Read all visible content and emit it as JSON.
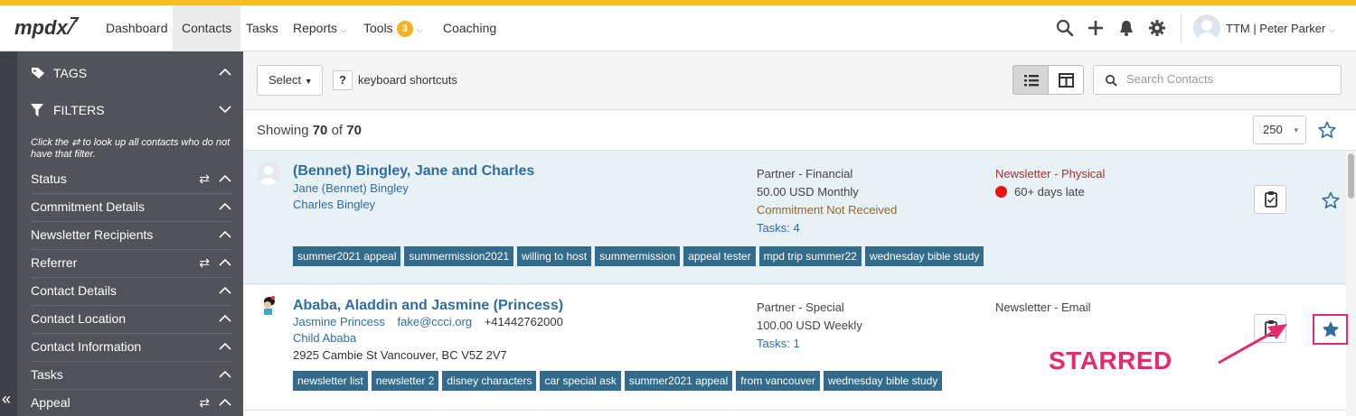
{
  "app": {
    "logo_text": "mpdx"
  },
  "nav": {
    "items": [
      {
        "label": "Dashboard"
      },
      {
        "label": "Contacts"
      },
      {
        "label": "Tasks"
      },
      {
        "label": "Reports"
      },
      {
        "label": "Tools"
      },
      {
        "label": "Coaching"
      }
    ],
    "tools_badge": "3",
    "user": "TTM | Peter Parker",
    "icons": [
      "search-icon",
      "plus-icon",
      "bell-icon",
      "gear-icon"
    ]
  },
  "sidebar": {
    "tags_label": "TAGS",
    "filters_label": "FILTERS",
    "hint_prefix": "Click the",
    "hint_suffix": "to look up all contacts who do not have that filter.",
    "rows": [
      {
        "label": "Status",
        "swap": true
      },
      {
        "label": "Commitment Details",
        "swap": false
      },
      {
        "label": "Newsletter Recipients",
        "swap": false
      },
      {
        "label": "Referrer",
        "swap": true
      },
      {
        "label": "Contact Details",
        "swap": false
      },
      {
        "label": "Contact Location",
        "swap": false
      },
      {
        "label": "Contact Information",
        "swap": false
      },
      {
        "label": "Tasks",
        "swap": false
      },
      {
        "label": "Appeal",
        "swap": true
      }
    ]
  },
  "toolbar": {
    "select_label": "Select",
    "help_glyph": "?",
    "shortcuts_label": "keyboard shortcuts",
    "search_placeholder": "Search Contacts"
  },
  "list": {
    "showing_prefix": "Showing",
    "shown": "70",
    "of_word": "of",
    "total": "70",
    "per_page": "250"
  },
  "contacts": [
    {
      "name": "(Bennet) Bingley, Jane and Charles",
      "people": [
        "Jane (Bennet) Bingley",
        "Charles Bingley"
      ],
      "status": "Partner - Financial",
      "pledge": "50.00 USD Monthly",
      "commitment": "Commitment Not Received",
      "tasks": "Tasks: 4",
      "newsletter": "Newsletter - Physical",
      "late": "60+ days late",
      "starred": false,
      "tags": [
        "summer2021 appeal",
        "summermission2021",
        "willing to host",
        "summermission",
        "appeal tester",
        "mpd trip summer22",
        "wednesday bible study"
      ]
    },
    {
      "name": "Ababa, Aladdin and Jasmine (Princess)",
      "people": [
        "Jasmine Princess",
        "Child Ababa"
      ],
      "email": "fake@ccci.org",
      "phone": "+41442762000",
      "address": "2925 Cambie St Vancouver, BC V5Z 2V7",
      "status": "Partner - Special",
      "pledge": "100.00 USD Weekly",
      "tasks": "Tasks: 1",
      "newsletter": "Newsletter - Email",
      "starred": true,
      "tags": [
        "newsletter list",
        "newsletter 2",
        "disney characters",
        "car special ask",
        "summer2021 appeal",
        "from vancouver",
        "wednesday bible study"
      ]
    }
  ],
  "annotation": {
    "label": "STARRED"
  },
  "colors": {
    "accent": "#f5c026",
    "sidebar": "#505459",
    "link": "#2f6ea0",
    "tag": "#336b8c",
    "annotation": "#e8296b"
  }
}
